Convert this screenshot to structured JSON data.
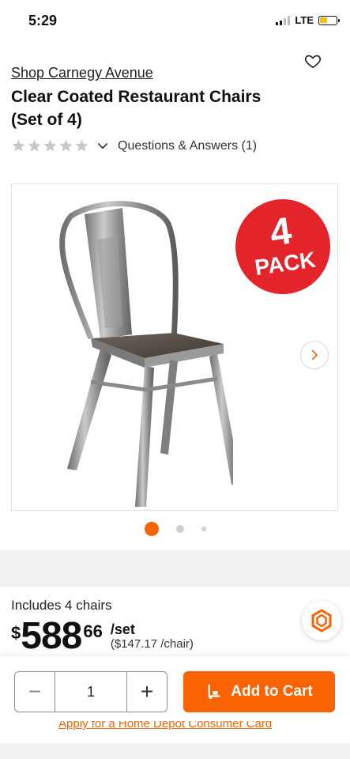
{
  "status_bar": {
    "time": "5:29",
    "network": "LTE",
    "battery_level": 0.45,
    "battery_color": "#f5c400"
  },
  "product": {
    "brand": "Shop Carnegy Avenue",
    "title": "Clear Coated Restaurant Chairs (Set of 4)",
    "rating_stars": 0,
    "rating_max": 5,
    "qa_label": "Questions & Answers (1)",
    "badge_number": "4",
    "badge_text": "PACK",
    "image_count": 3,
    "current_image": 1,
    "includes": "Includes 4 chairs",
    "price": {
      "currency": "$",
      "dollars": "588",
      "cents": "66",
      "unit": "/set",
      "per_item": "($147.17 /chair)"
    }
  },
  "icons": {
    "favorite": "heart-outline-icon",
    "expand": "chevron-down-icon",
    "next_image": "chevron-right-icon",
    "badge": "hexagon-badge-icon",
    "cart": "dolly-cart-icon",
    "decrement": "minus-icon",
    "increment": "plus-icon"
  },
  "cart_bar": {
    "quantity": "1",
    "decrement_label": "−",
    "increment_label": "+",
    "add_to_cart_label": "Add to Cart",
    "credit_link": "Apply for a Home Depot Consumer Card"
  },
  "colors": {
    "accent": "#f96302",
    "star_empty": "#c9c9c9",
    "badge_red": "#e3242b"
  }
}
